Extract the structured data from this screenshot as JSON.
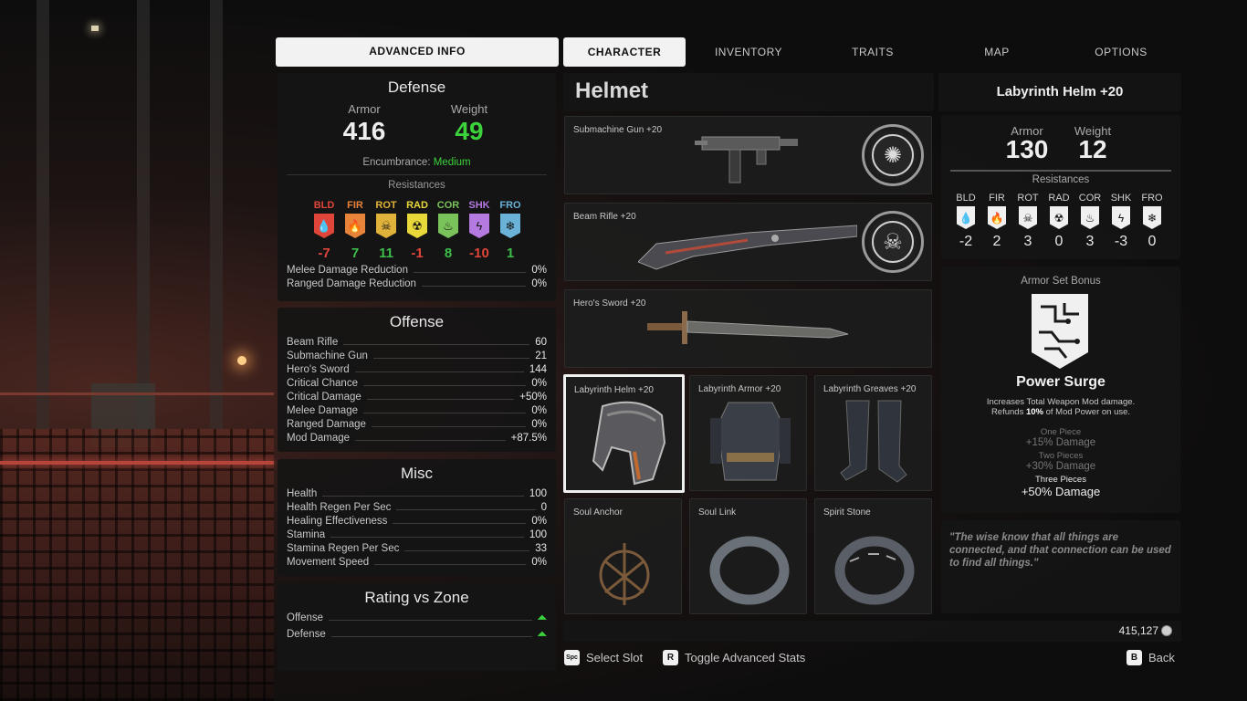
{
  "tabs": {
    "advanced_info": "ADVANCED INFO",
    "character": "CHARACTER",
    "inventory": "INVENTORY",
    "traits": "TRAITS",
    "map": "MAP",
    "options": "OPTIONS"
  },
  "defense": {
    "title": "Defense",
    "armor_label": "Armor",
    "armor_value": "416",
    "weight_label": "Weight",
    "weight_value": "49",
    "encumbrance_label": "Encumbrance:",
    "encumbrance_value": "Medium",
    "resistances_title": "Resistances",
    "resistances": [
      {
        "abbr": "BLD",
        "value": "-7",
        "color": "#e0453a",
        "icon": "blood-drop-icon",
        "glyph": "💧"
      },
      {
        "abbr": "FIR",
        "value": "7",
        "color": "#e8833a",
        "icon": "fire-icon",
        "glyph": "🔥"
      },
      {
        "abbr": "ROT",
        "value": "11",
        "color": "#e0b23a",
        "icon": "skull-icon",
        "glyph": "☠"
      },
      {
        "abbr": "RAD",
        "value": "-1",
        "color": "#e8d83a",
        "icon": "radiation-icon",
        "glyph": "☢"
      },
      {
        "abbr": "COR",
        "value": "8",
        "color": "#7ac25a",
        "icon": "corrosion-icon",
        "glyph": "♨"
      },
      {
        "abbr": "SHK",
        "value": "-10",
        "color": "#b47ae0",
        "icon": "shock-icon",
        "glyph": "ϟ"
      },
      {
        "abbr": "FRO",
        "value": "1",
        "color": "#6ab2d8",
        "icon": "frost-icon",
        "glyph": "❄"
      }
    ],
    "rows": [
      {
        "label": "Melee Damage Reduction",
        "value": "0%"
      },
      {
        "label": "Ranged Damage Reduction",
        "value": "0%"
      }
    ]
  },
  "offense": {
    "title": "Offense",
    "rows": [
      {
        "label": "Beam Rifle",
        "value": "60"
      },
      {
        "label": "Submachine Gun",
        "value": "21"
      },
      {
        "label": "Hero's Sword",
        "value": "144"
      },
      {
        "label": "Critical Chance",
        "value": "0%"
      },
      {
        "label": "Critical Damage",
        "value": "+50%"
      },
      {
        "label": "Melee Damage",
        "value": "0%"
      },
      {
        "label": "Ranged Damage",
        "value": "0%"
      },
      {
        "label": "Mod Damage",
        "value": "+87.5%"
      }
    ]
  },
  "misc": {
    "title": "Misc",
    "rows": [
      {
        "label": "Health",
        "value": "100"
      },
      {
        "label": "Health Regen Per Sec",
        "value": "0"
      },
      {
        "label": "Healing Effectiveness",
        "value": "0%"
      },
      {
        "label": "Stamina",
        "value": "100"
      },
      {
        "label": "Stamina Regen Per Sec",
        "value": "33"
      },
      {
        "label": "Movement Speed",
        "value": "0%"
      }
    ]
  },
  "rating": {
    "title": "Rating vs Zone",
    "rows": [
      {
        "label": "Offense",
        "icon": "double-chevron-up-icon"
      },
      {
        "label": "Defense",
        "icon": "double-chevron-up-icon"
      }
    ]
  },
  "category_title": "Helmet",
  "slots": [
    {
      "name": "Submachine Gun +20",
      "key": "smg"
    },
    {
      "name": "Beam Rifle +20",
      "key": "beam-rifle"
    },
    {
      "name": "Hero's Sword +20",
      "key": "sword"
    },
    {
      "name": "Labyrinth Helm +20",
      "key": "helm"
    },
    {
      "name": "Labyrinth Armor +20",
      "key": "armor"
    },
    {
      "name": "Labyrinth Greaves +20",
      "key": "greaves"
    },
    {
      "name": "Soul Anchor",
      "key": "amulet"
    },
    {
      "name": "Soul Link",
      "key": "ring1"
    },
    {
      "name": "Spirit Stone",
      "key": "ring2"
    }
  ],
  "currency": {
    "amount": "415,127"
  },
  "detail": {
    "item_name": "Labyrinth Helm +20",
    "armor_label": "Armor",
    "armor_value": "130",
    "weight_label": "Weight",
    "weight_value": "12",
    "resistances_title": "Resistances",
    "resistances": [
      {
        "abbr": "BLD",
        "value": "-2",
        "glyph": "💧"
      },
      {
        "abbr": "FIR",
        "value": "2",
        "glyph": "🔥"
      },
      {
        "abbr": "ROT",
        "value": "3",
        "glyph": "☠"
      },
      {
        "abbr": "RAD",
        "value": "0",
        "glyph": "☢"
      },
      {
        "abbr": "COR",
        "value": "3",
        "glyph": "♨"
      },
      {
        "abbr": "SHK",
        "value": "-3",
        "glyph": "ϟ"
      },
      {
        "abbr": "FRO",
        "value": "0",
        "glyph": "❄"
      }
    ],
    "set_bonus_title": "Armor Set Bonus",
    "set_name": "Power Surge",
    "set_desc_1": "Increases Total Weapon Mod damage.",
    "set_desc_2a": "Refunds ",
    "set_desc_2b": "10%",
    "set_desc_2c": " of Mod Power on use.",
    "tiers": [
      {
        "label": "One Piece",
        "value": "+15% Damage"
      },
      {
        "label": "Two Pieces",
        "value": "+30% Damage"
      },
      {
        "label": "Three Pieces",
        "value": "+50% Damage"
      }
    ],
    "quote": "\"The wise know that all things are connected, and that connection can be used to find all things.\""
  },
  "hints": {
    "select_key": "Spc",
    "select_label": "Select Slot",
    "toggle_key": "R",
    "toggle_label": "Toggle Advanced Stats",
    "back_key": "B",
    "back_label": "Back"
  }
}
